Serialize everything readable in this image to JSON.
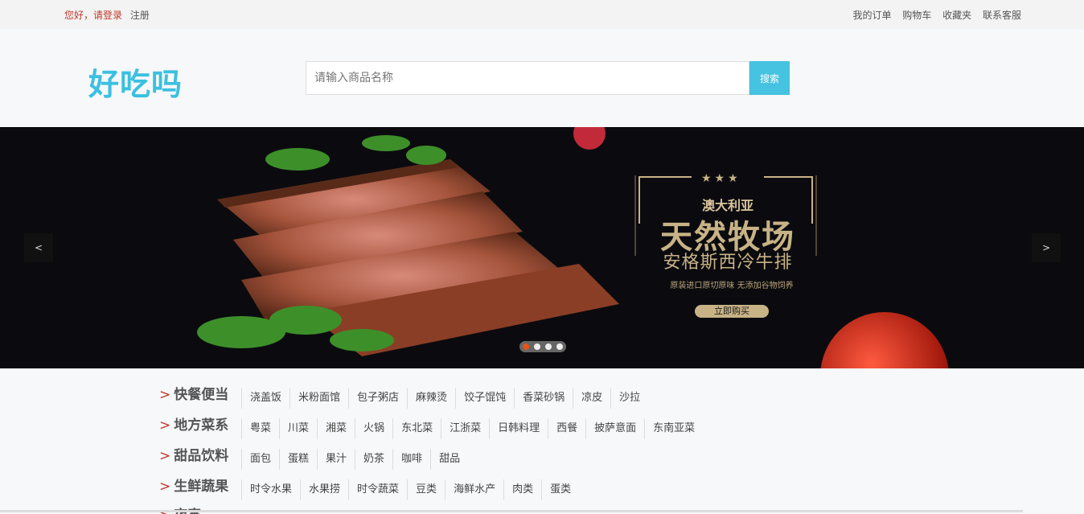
{
  "topbar": {
    "hello": "您好，",
    "login": "请登录",
    "register": "注册",
    "links": [
      "我的订单",
      "购物车",
      "收藏夹",
      "联系客服"
    ]
  },
  "header": {
    "logo": "好吃吗",
    "search_placeholder": "请输入商品名称",
    "search_button": "搜索"
  },
  "banner": {
    "prev": "<",
    "next": ">",
    "stars": "★★★",
    "title1": "澳大利亚",
    "title2": "天然牧场",
    "title3": "安格斯西冷牛排",
    "title4": "原装进口原切原味 无添加谷物饲养",
    "buy": "立即购买",
    "slide_count": 4,
    "active_slide": 0
  },
  "categories": [
    {
      "title": "快餐便当",
      "items": [
        "浇盖饭",
        "米粉面馆",
        "包子粥店",
        "麻辣烫",
        "饺子馄饨",
        "香菜砂锅",
        "凉皮",
        "沙拉"
      ]
    },
    {
      "title": "地方菜系",
      "items": [
        "粤菜",
        "川菜",
        "湘菜",
        "火锅",
        "东北菜",
        "江浙菜",
        "日韩料理",
        "西餐",
        "披萨意面",
        "东南亚菜"
      ]
    },
    {
      "title": "甜品饮料",
      "items": [
        "面包",
        "蛋糕",
        "果汁",
        "奶茶",
        "咖啡",
        "甜品"
      ]
    },
    {
      "title": "生鲜蔬果",
      "items": [
        "时令水果",
        "水果捞",
        "时令蔬菜",
        "豆类",
        "海鲜水产",
        "肉类",
        "蛋类"
      ]
    },
    {
      "title": "夜宵",
      "items": []
    }
  ],
  "colors": {
    "accent": "#45c3e0",
    "logo": "#3bc0e0",
    "link_red": "#c0392b",
    "banner_gold": "#c8b386"
  }
}
